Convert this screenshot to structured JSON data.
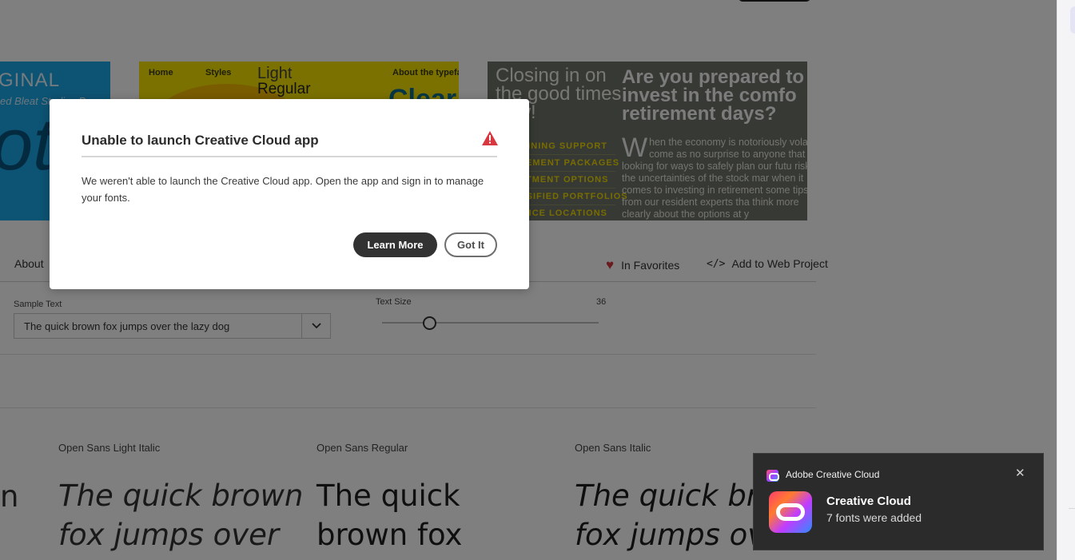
{
  "specimens": {
    "spec1": {
      "line1": "GINAL",
      "line2": "ed Bleat Studios Pro",
      "big": "ota"
    },
    "spec2": {
      "nav": [
        "Home",
        "Styles",
        "About the typefa"
      ],
      "light": "Light",
      "regular": "Regular",
      "big": "Clear"
    },
    "spec3": {
      "left_text": "Closing in on the good times now!",
      "menu": [
        "PLANNING SUPPORT",
        "RETIREMENT PACKAGES",
        "INVESTMENT OPTIONS",
        "DIVERSIFIED PORTFOLIOS",
        "OFFICE LOCATIONS"
      ],
      "headline": [
        "Are you prepared to",
        "invest in the comfo",
        "retirement days?"
      ],
      "body_dropcap": "W",
      "body": "hen the economy is notoriously vola come as no surprise to anyone that are looking for ways to safely plan our futu risking the uncertainties of the stock mar when it comes to investing in retirement some tips from our resident experts tha think more clearly about the options at y"
    }
  },
  "toolbar": {
    "about_tab": "About",
    "favorites_label": "In Favorites",
    "web_project_label": "Add to Web Project"
  },
  "controls": {
    "sample_text_label": "Sample Text",
    "sample_text_value": "The quick brown fox jumps over the lazy dog",
    "text_size_label": "Text Size",
    "text_size_value": "36",
    "text_size_fraction": 0.22
  },
  "fonts": [
    {
      "name": "Open Sans Light Italic",
      "preview": "The quick brown fox jumps over"
    },
    {
      "name": "Open Sans Regular",
      "preview": "The quick brown fox"
    },
    {
      "name": "Open Sans Italic",
      "preview": "The quick brown fox jumps over"
    }
  ],
  "edge_preview": "n",
  "modal": {
    "title": "Unable to launch Creative Cloud app",
    "message": "We weren't able to launch the Creative Cloud app. Open the app and sign in to manage your fonts.",
    "learn_more": "Learn More",
    "got_it": "Got It"
  },
  "toast": {
    "app_name": "Adobe Creative Cloud",
    "heading": "Creative Cloud",
    "subtext": "7 fonts were added",
    "close_glyph": "✕"
  },
  "colors": {
    "overlay": "rgba(0,0,0,0.50)",
    "favorite_heart": "#d7373f",
    "warning": "#d7373f",
    "primary_button": "#323232"
  }
}
